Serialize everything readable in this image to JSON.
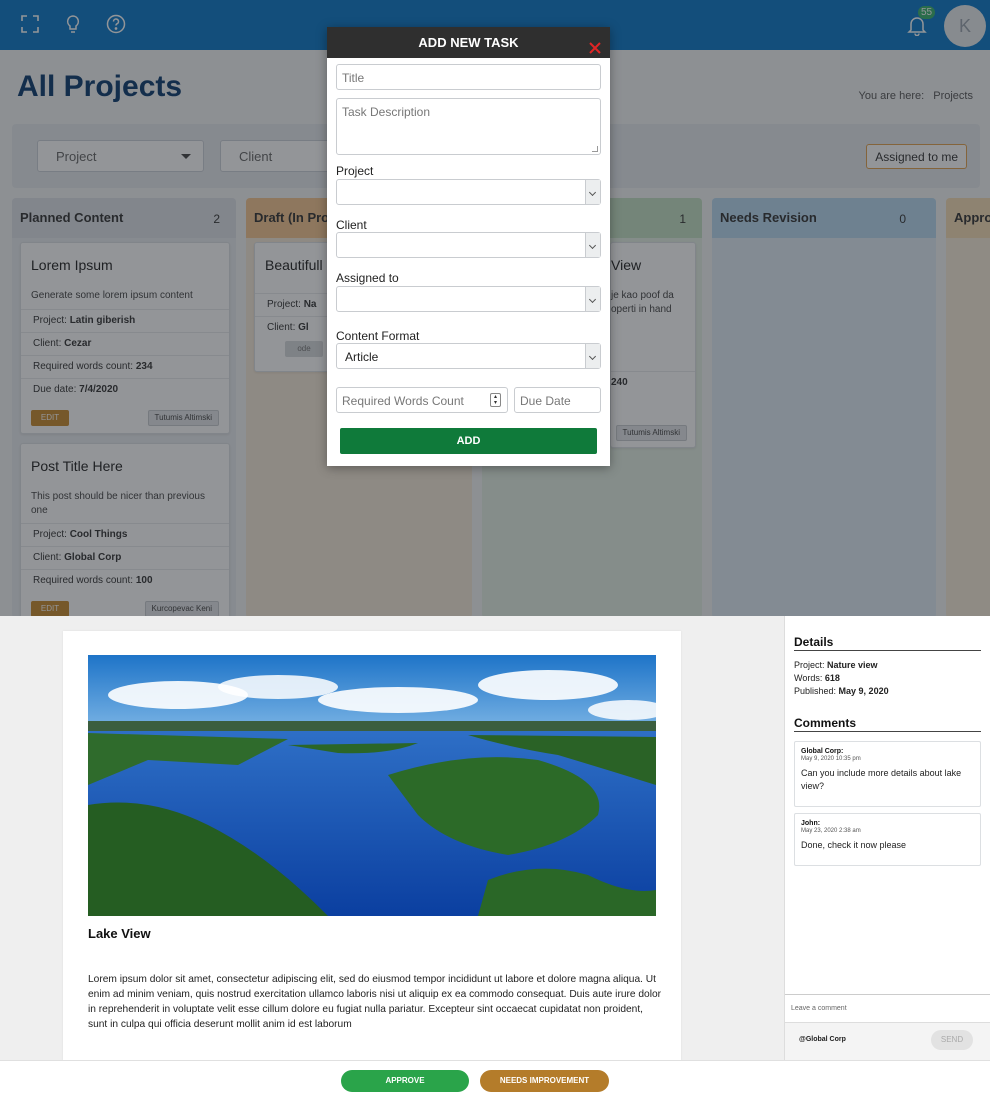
{
  "app": {
    "notification_count": "55",
    "avatar_initial": "K",
    "page_title": "All Projects",
    "breadcrumb_prefix": "You are here:",
    "breadcrumb_current": "Projects"
  },
  "filters": {
    "project_label": "Project",
    "client_label": "Client",
    "assigned_label": "Assigned to me"
  },
  "columns": [
    {
      "title": "Planned Content",
      "count": "2",
      "color": "#dfe3e8"
    },
    {
      "title": "Draft (In Progress)",
      "count": "",
      "color": "#f5c690"
    },
    {
      "title": "",
      "count": "1",
      "color": "#c4e0c4"
    },
    {
      "title": "Needs Revision",
      "count": "0",
      "color": "#b8d8f0"
    },
    {
      "title": "Appro",
      "count": "",
      "color": "#f5dcb4"
    }
  ],
  "cards": {
    "c1": {
      "title": "Lorem Ipsum",
      "desc": "Generate some lorem ipsum content",
      "project_label": "Project:",
      "project": "Latin giberish",
      "client_label": "Client:",
      "client": "Cezar",
      "words_label": "Required words count:",
      "words": "234",
      "due_label": "Due date:",
      "due": "7/4/2020",
      "edit": "EDIT",
      "assignee": "Tutumis Altimski"
    },
    "c2": {
      "title": "Post Title Here",
      "desc": "This post should be nicer than previous one",
      "project_label": "Project:",
      "project": "Cool Things",
      "client_label": "Client:",
      "client": "Global Corp",
      "words_label": "Required words count:",
      "words": "100",
      "edit": "EDIT",
      "assignee": "Kurcopevac Keni"
    },
    "c3": {
      "title": "Beautifull",
      "project_label": "Project:",
      "project": "Na",
      "client_label": "Client:",
      "client": "Gl",
      "edit": "ode"
    },
    "c4": {
      "title": "View",
      "desc1": "je kao poof da",
      "desc2": "operti in hand",
      "words": "240",
      "assignee": "Tutumis Altimski"
    }
  },
  "modal": {
    "title": "ADD NEW TASK",
    "title_placeholder": "Title",
    "desc_placeholder": "Task Description",
    "project_label": "Project",
    "client_label": "Client",
    "assigned_label": "Assigned to",
    "format_label": "Content Format",
    "format_value": "Article",
    "words_placeholder": "Required Words Count",
    "due_placeholder": "Due Date",
    "add_button": "ADD"
  },
  "article": {
    "title": "Lake View",
    "body": "Lorem ipsum dolor sit amet, consectetur adipiscing elit, sed do eiusmod tempor incididunt ut labore et dolore magna aliqua. Ut enim ad minim veniam, quis nostrud exercitation ullamco laboris nisi ut aliquip ex ea commodo consequat. Duis aute irure dolor in reprehenderit in voluptate velit esse cillum dolore eu fugiat nulla pariatur. Excepteur sint occaecat cupidatat non proident, sunt in culpa qui officia deserunt mollit anim id est laborum"
  },
  "details": {
    "heading": "Details",
    "project_label": "Project:",
    "project": "Nature view",
    "words_label": "Words:",
    "words": "618",
    "published_label": "Published:",
    "published": "May 9, 2020"
  },
  "comments": {
    "heading": "Comments",
    "items": [
      {
        "author": "Global Corp:",
        "date": "May 9, 2020 10:35 pm",
        "text": "Can you include more details about lake view?"
      },
      {
        "author": "John:",
        "date": "May 23, 2020 2:38 am",
        "text": "Done, check it now please"
      }
    ],
    "leave_placeholder": "Leave a comment",
    "mention": "@Global Corp",
    "send": "SEND"
  },
  "actions": {
    "approve": "APPROVE",
    "needs_improvement": "NEEDS IMPROVEMENT"
  },
  "icons": {
    "topbar": [
      "fullscreen-icon",
      "lightbulb-icon",
      "help-icon",
      "bell-icon"
    ],
    "modal_close": "close-icon"
  },
  "colors": {
    "topbar": "#0a78c8",
    "title": "#0b3a6d",
    "add_button": "#0f7a3a",
    "approve": "#2aa44a",
    "needs_improvement": "#b47c2a",
    "edit_button": "#c88a2c"
  }
}
